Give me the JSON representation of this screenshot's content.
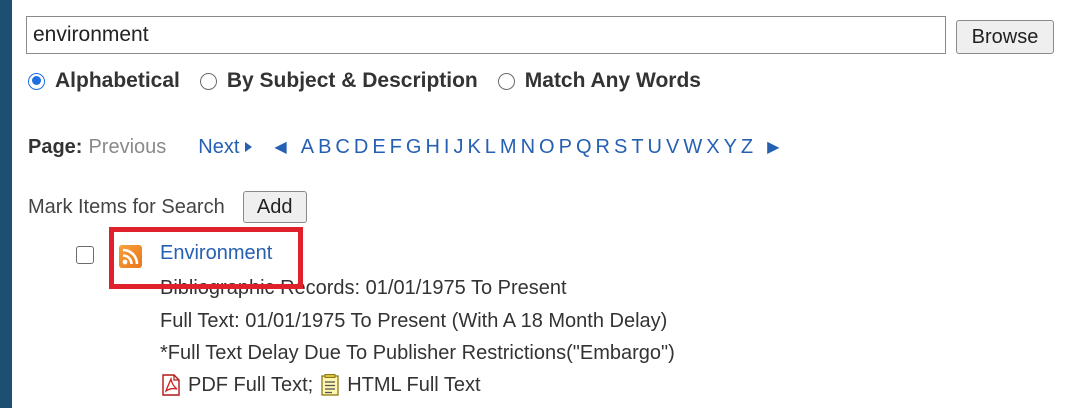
{
  "search": {
    "value": "environment",
    "browse_label": "Browse"
  },
  "radio_options": [
    {
      "label": "Alphabetical",
      "checked": true
    },
    {
      "label": "By Subject & Description",
      "checked": false
    },
    {
      "label": "Match Any Words",
      "checked": false
    }
  ],
  "pagination": {
    "page_label": "Page:",
    "previous_label": "Previous",
    "next_label": "Next",
    "letters": [
      "A",
      "B",
      "C",
      "D",
      "E",
      "F",
      "G",
      "H",
      "I",
      "J",
      "K",
      "L",
      "M",
      "N",
      "O",
      "P",
      "Q",
      "R",
      "S",
      "T",
      "U",
      "V",
      "W",
      "X",
      "Y",
      "Z"
    ]
  },
  "mark": {
    "label": "Mark Items for Search",
    "add_label": "Add"
  },
  "result": {
    "title": "Environment",
    "bibliographic": "Bibliographic Records:  01/01/1975 To Present",
    "full_text": "Full Text:  01/01/1975 To Present (With A 18 Month Delay)",
    "embargo_note": "*Full Text Delay Due To Publisher Restrictions(\"Embargo\")",
    "pdf_label": "PDF Full Text;",
    "html_label": "HTML Full Text"
  },
  "colors": {
    "frame": "#1d4f73",
    "link": "#2660b2",
    "highlight": "#e0202a",
    "rss": "#e8761b",
    "radio_selected": "#1f6fe0"
  },
  "icons": {
    "rss": "rss-icon",
    "pdf": "pdf-icon",
    "html": "html-document-icon",
    "prev_letters": "triangle-left-icon",
    "next_letters": "triangle-right-icon"
  }
}
